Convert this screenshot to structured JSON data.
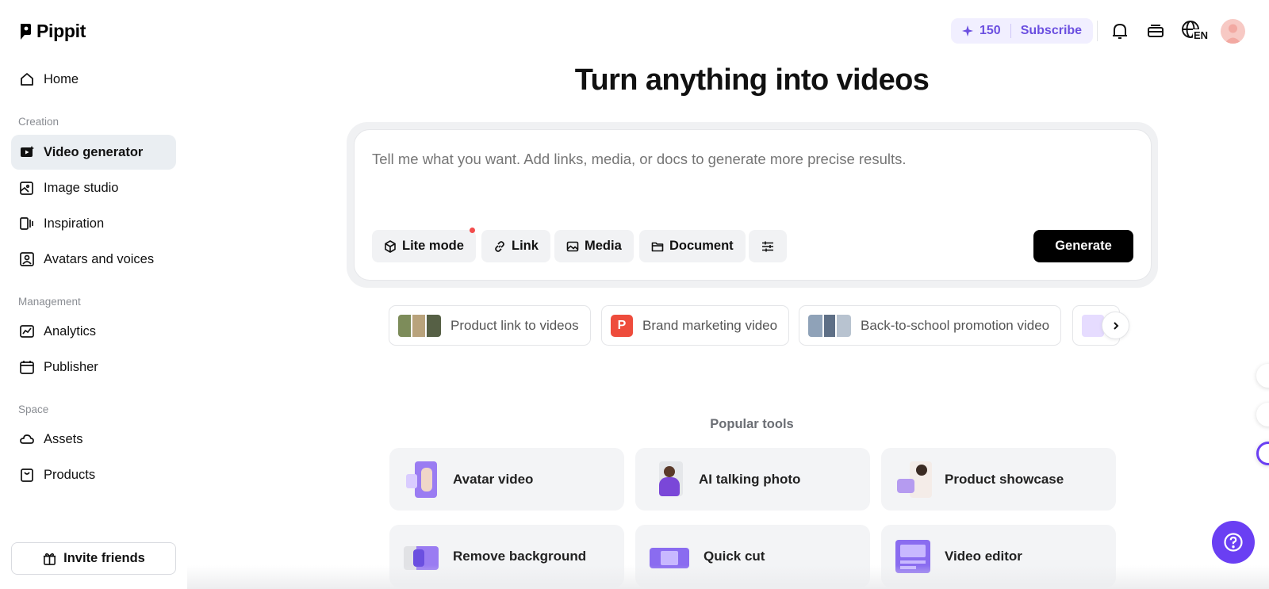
{
  "brand": {
    "name": "Pippit"
  },
  "sidebar": {
    "home": "Home",
    "sections": [
      {
        "label": "Creation"
      },
      {
        "label": "Management"
      },
      {
        "label": "Space"
      }
    ],
    "creation_items": [
      {
        "label": "Video generator",
        "icon": "video-icon",
        "active": true
      },
      {
        "label": "Image studio",
        "icon": "image-sparkle-icon"
      },
      {
        "label": "Inspiration",
        "icon": "inspiration-icon"
      },
      {
        "label": "Avatars and voices",
        "icon": "avatar-voice-icon"
      }
    ],
    "management_items": [
      {
        "label": "Analytics",
        "icon": "analytics-icon"
      },
      {
        "label": "Publisher",
        "icon": "calendar-icon"
      }
    ],
    "space_items": [
      {
        "label": "Assets",
        "icon": "cloud-icon"
      },
      {
        "label": "Products",
        "icon": "bag-icon"
      }
    ],
    "invite": "Invite friends"
  },
  "topbar": {
    "credits": "150",
    "subscribe": "Subscribe",
    "language": "EN",
    "accent": "#6b4fe0"
  },
  "main": {
    "title": "Turn anything into videos",
    "prompt_placeholder": "Tell me what you want. Add links, media, or docs to generate more precise results.",
    "tools": [
      {
        "label": "Lite mode",
        "icon": "cube-icon"
      },
      {
        "label": "Link",
        "icon": "link-icon"
      },
      {
        "label": "Media",
        "icon": "image-icon"
      },
      {
        "label": "Document",
        "icon": "folder-icon"
      }
    ],
    "generate": "Generate",
    "chips": [
      {
        "label": "Product link to videos"
      },
      {
        "label": "Brand marketing video",
        "badge": "P"
      },
      {
        "label": "Back-to-school promotion video"
      }
    ],
    "popular_label": "Popular tools",
    "popular_tools": [
      {
        "label": "Avatar video"
      },
      {
        "label": "AI talking photo"
      },
      {
        "label": "Product showcase"
      },
      {
        "label": "Remove background"
      },
      {
        "label": "Quick cut"
      },
      {
        "label": "Video editor"
      }
    ]
  }
}
